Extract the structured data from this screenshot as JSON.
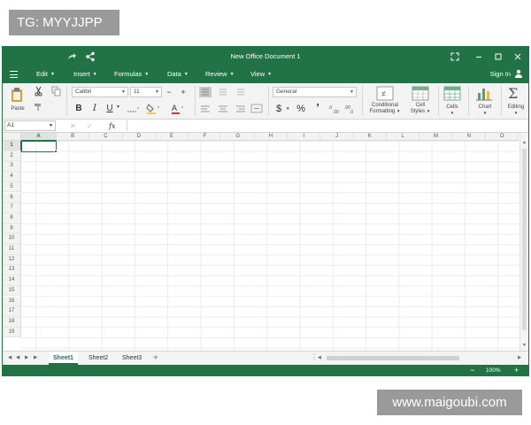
{
  "watermarks": {
    "top": "TG: MYYJJPP",
    "bottom": "www.maigoubi.com"
  },
  "window": {
    "title": "New Office Document 1"
  },
  "menu": {
    "items": [
      {
        "label": "Edit"
      },
      {
        "label": "Insert"
      },
      {
        "label": "Formulas"
      },
      {
        "label": "Data"
      },
      {
        "label": "Review"
      },
      {
        "label": "View"
      }
    ],
    "sign_in": "Sign In"
  },
  "ribbon": {
    "paste": "Paste",
    "font_name": "Calibri",
    "font_size": "11",
    "bold": "B",
    "italic": "I",
    "underline": "U",
    "number_format": "General",
    "currency": "$",
    "percent": "%",
    "comma": "’",
    "conditional_formatting": [
      "Conditional",
      "Formatting"
    ],
    "cell_styles": [
      "Cell",
      "Styles"
    ],
    "cells": "Cells",
    "chart": "Chart",
    "editing": "Editing"
  },
  "formula_bar": {
    "name_box": "A1",
    "fx": "fx",
    "value": ""
  },
  "grid": {
    "columns": [
      "A",
      "B",
      "C",
      "D",
      "E",
      "F",
      "G",
      "H",
      "I",
      "J",
      "K",
      "L",
      "M",
      "N",
      "O"
    ],
    "rows": [
      "1",
      "2",
      "3",
      "4",
      "5",
      "6",
      "7",
      "8",
      "9",
      "10",
      "11",
      "12",
      "13",
      "14",
      "15",
      "16",
      "17",
      "18",
      "19"
    ],
    "active_cell": "A1"
  },
  "sheets": [
    {
      "label": "Sheet1",
      "active": true
    },
    {
      "label": "Sheet2",
      "active": false
    },
    {
      "label": "Sheet3",
      "active": false
    }
  ],
  "status": {
    "zoom": "100%"
  },
  "colors": {
    "accent": "#217346",
    "ribbon_bg": "#f3f3f3",
    "watermark_bg": "#9a9a9a"
  }
}
